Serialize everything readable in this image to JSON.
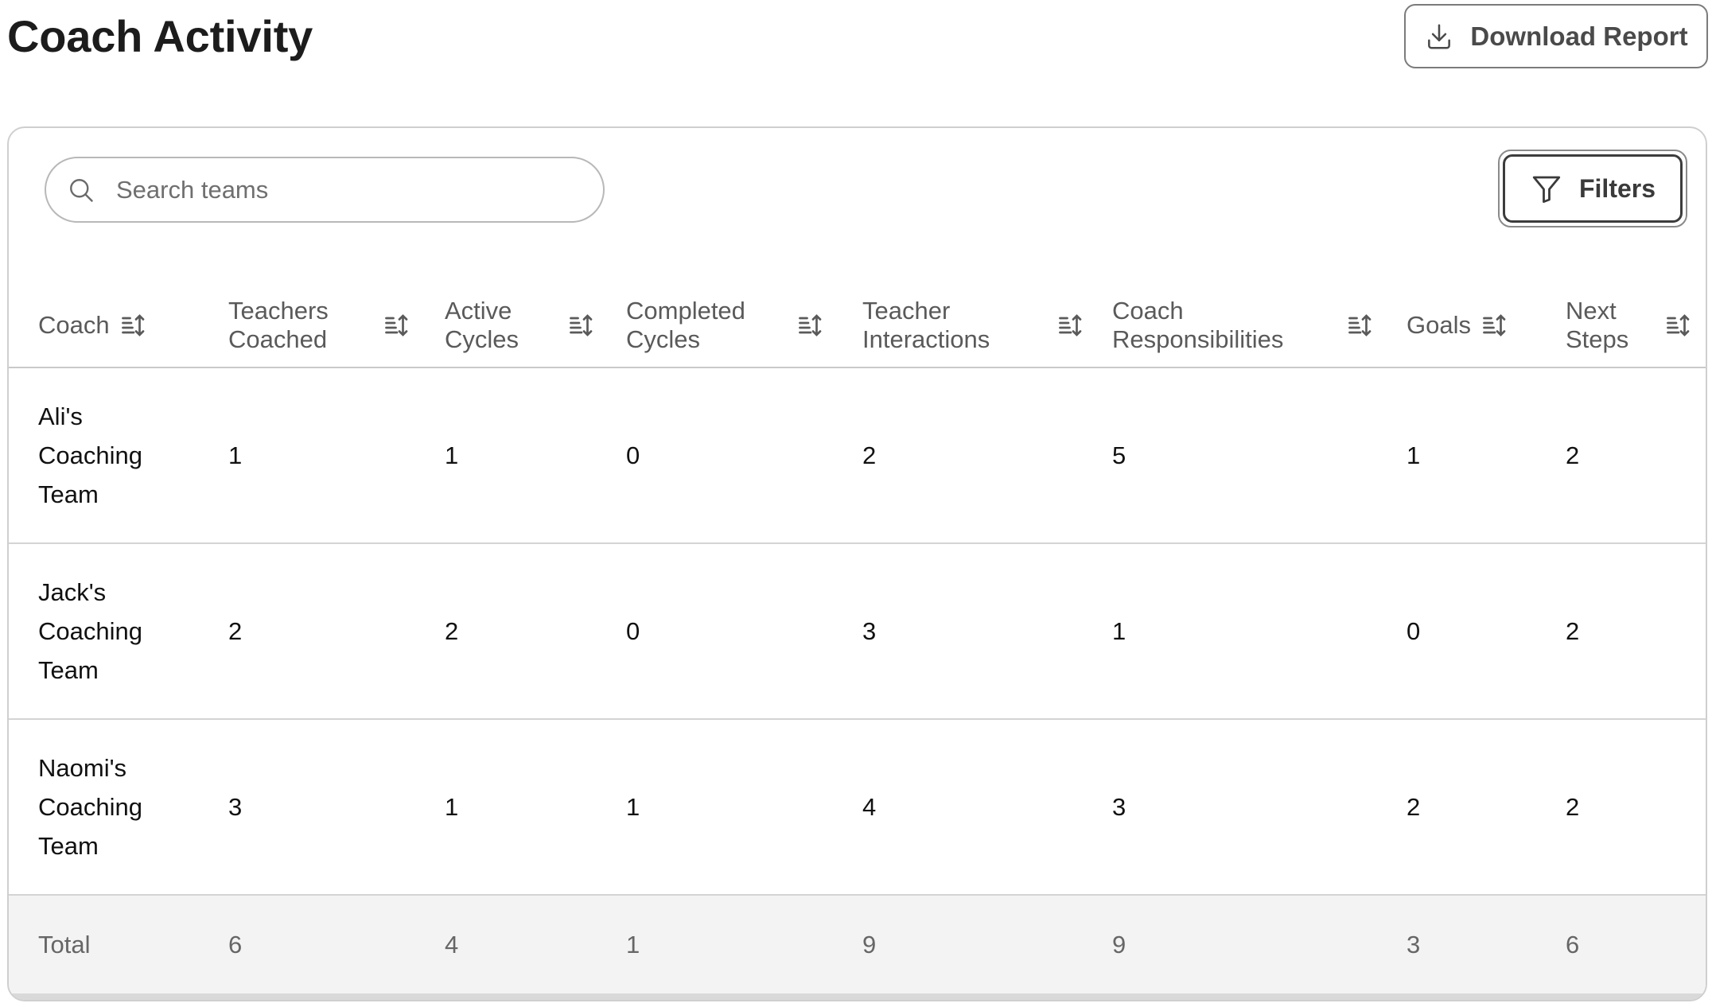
{
  "page": {
    "title": "Coach Activity"
  },
  "toolbar": {
    "download_label": "Download Report"
  },
  "search": {
    "placeholder": "Search teams",
    "value": ""
  },
  "filters": {
    "label": "Filters"
  },
  "table": {
    "columns": [
      "Coach",
      "Teachers Coached",
      "Active Cycles",
      "Completed Cycles",
      "Teacher Interactions",
      "Coach Responsibilities",
      "Goals",
      "Next Steps"
    ],
    "rows": [
      {
        "coach": "Ali's Coaching Team",
        "values": [
          "1",
          "1",
          "0",
          "2",
          "5",
          "1",
          "2"
        ]
      },
      {
        "coach": "Jack's Coaching Team",
        "values": [
          "2",
          "2",
          "0",
          "3",
          "1",
          "0",
          "2"
        ]
      },
      {
        "coach": "Naomi's Coaching Team",
        "values": [
          "3",
          "1",
          "1",
          "4",
          "3",
          "2",
          "2"
        ]
      }
    ],
    "total": {
      "label": "Total",
      "values": [
        "6",
        "4",
        "1",
        "9",
        "9",
        "3",
        "6"
      ]
    }
  },
  "icons": {
    "download": "download-icon",
    "search": "search-icon",
    "filter": "filter-funnel-icon",
    "sort": "sort-icon"
  }
}
